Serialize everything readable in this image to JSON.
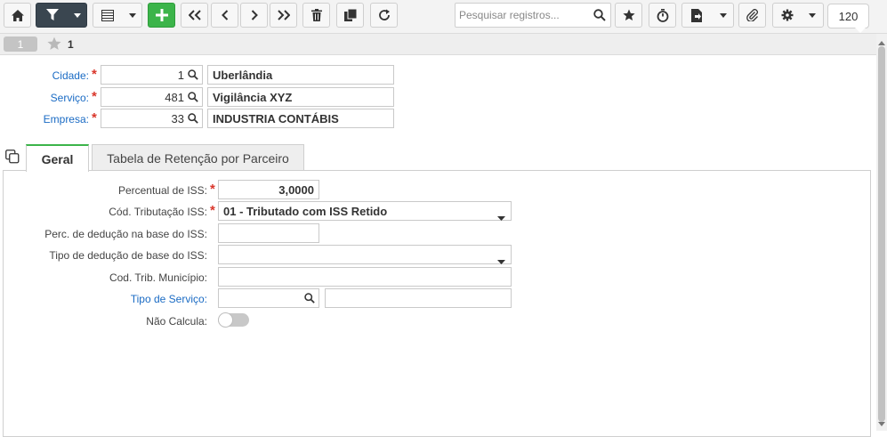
{
  "toolbar": {
    "icons": [
      "home-icon",
      "filter-icon",
      "grid-icon",
      "add-icon",
      "first-icon",
      "previous-icon",
      "next-icon",
      "last-icon",
      "delete-icon",
      "duplicate-icon",
      "refresh-icon",
      "favorite-icon",
      "timer-icon",
      "report-icon",
      "attachment-icon",
      "gear-icon"
    ],
    "search_placeholder": "Pesquisar registros...",
    "page_size": "120"
  },
  "record_strip": {
    "record_number": "1",
    "favorite_count": "1"
  },
  "header_form": {
    "cidade": {
      "label": "Cidade:",
      "code": "1",
      "description": "Uberlândia"
    },
    "servico": {
      "label": "Serviço:",
      "code": "481",
      "description": "Vigilância XYZ"
    },
    "empresa": {
      "label": "Empresa:",
      "code": "33",
      "description": "INDUSTRIA CONTÁBIS"
    }
  },
  "tabs": [
    {
      "label": "Geral",
      "active": true
    },
    {
      "label": "Tabela de Retenção por Parceiro",
      "active": false
    }
  ],
  "geral": {
    "percentual_iss": {
      "label": "Percentual de ISS:",
      "value": "3,0000"
    },
    "cod_tributacao": {
      "label": "Cód. Tributação ISS:",
      "value": "01 - Tributado com ISS Retido"
    },
    "perc_deducao": {
      "label": "Perc. de dedução na base do ISS:",
      "value": ""
    },
    "tipo_deducao": {
      "label": "Tipo de dedução de base do ISS:",
      "value": ""
    },
    "cod_trib_municipio": {
      "label": "Cod. Trib. Município:",
      "value": ""
    },
    "tipo_servico": {
      "label": "Tipo de Serviço:",
      "code": "",
      "description": ""
    },
    "nao_calcula": {
      "label": "Não Calcula:",
      "enabled": false
    }
  },
  "colors": {
    "accent_green": "#3cb44a",
    "link_blue": "#1a6bc4",
    "required_red": "#d9362b",
    "toolbar_dark": "#3a4650"
  }
}
